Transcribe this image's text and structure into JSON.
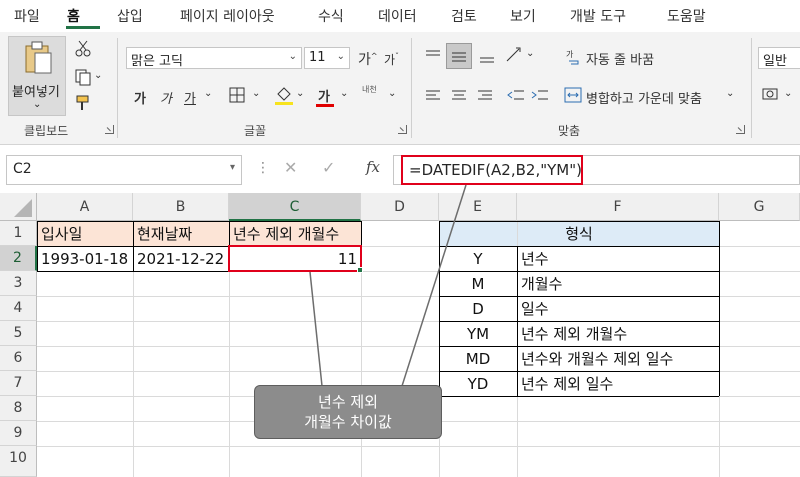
{
  "tabs": [
    "파일",
    "홈",
    "삽입",
    "페이지 레이아웃",
    "수식",
    "데이터",
    "검토",
    "보기",
    "개발 도구",
    "도움말"
  ],
  "active_tab": "홈",
  "ribbon": {
    "clipboard": {
      "paste_label": "붙여넣기",
      "group_label": "클립보드"
    },
    "font": {
      "font_name": "맑은 고딕",
      "font_size": "11",
      "bold": "가",
      "italic": "가",
      "underline": "가",
      "font_color_glyph": "가",
      "phonetic_glyph": "내천",
      "group_label": "글꼴",
      "grow": "가",
      "shrink": "가"
    },
    "alignment": {
      "wrap_text": "자동 줄 바꿈",
      "merge_center": "병합하고 가운데 맞춤",
      "group_label": "맞춤"
    },
    "number": {
      "format": "일반"
    },
    "colors": {
      "accent": "#217346",
      "font_color_bar": "#e00000"
    }
  },
  "formula_bar": {
    "name_box": "C2",
    "fx": "fx",
    "formula": "=DATEDIF(A2,B2,\"YM\")"
  },
  "columns": [
    "A",
    "B",
    "C",
    "D",
    "E",
    "F",
    "G"
  ],
  "rows": [
    "1",
    "2",
    "3",
    "4",
    "5",
    "6",
    "7",
    "8",
    "9",
    "10"
  ],
  "cells": {
    "A1": "입사일",
    "B1": "현재날짜",
    "C1": "년수 제외 개월수",
    "A2": "1993-01-18",
    "B2": "2021-12-22",
    "C2": "11"
  },
  "format_table": {
    "header": "형식",
    "rows": [
      {
        "code": "Y",
        "desc": "년수"
      },
      {
        "code": "M",
        "desc": "개월수"
      },
      {
        "code": "D",
        "desc": "일수"
      },
      {
        "code": "YM",
        "desc": "년수 제외 개월수"
      },
      {
        "code": "MD",
        "desc": "년수와 개월수 제외 일수"
      },
      {
        "code": "YD",
        "desc": "년수 제외 일수"
      }
    ]
  },
  "callout": {
    "line1": "년수 제외",
    "line2": "개월수 차이값"
  }
}
